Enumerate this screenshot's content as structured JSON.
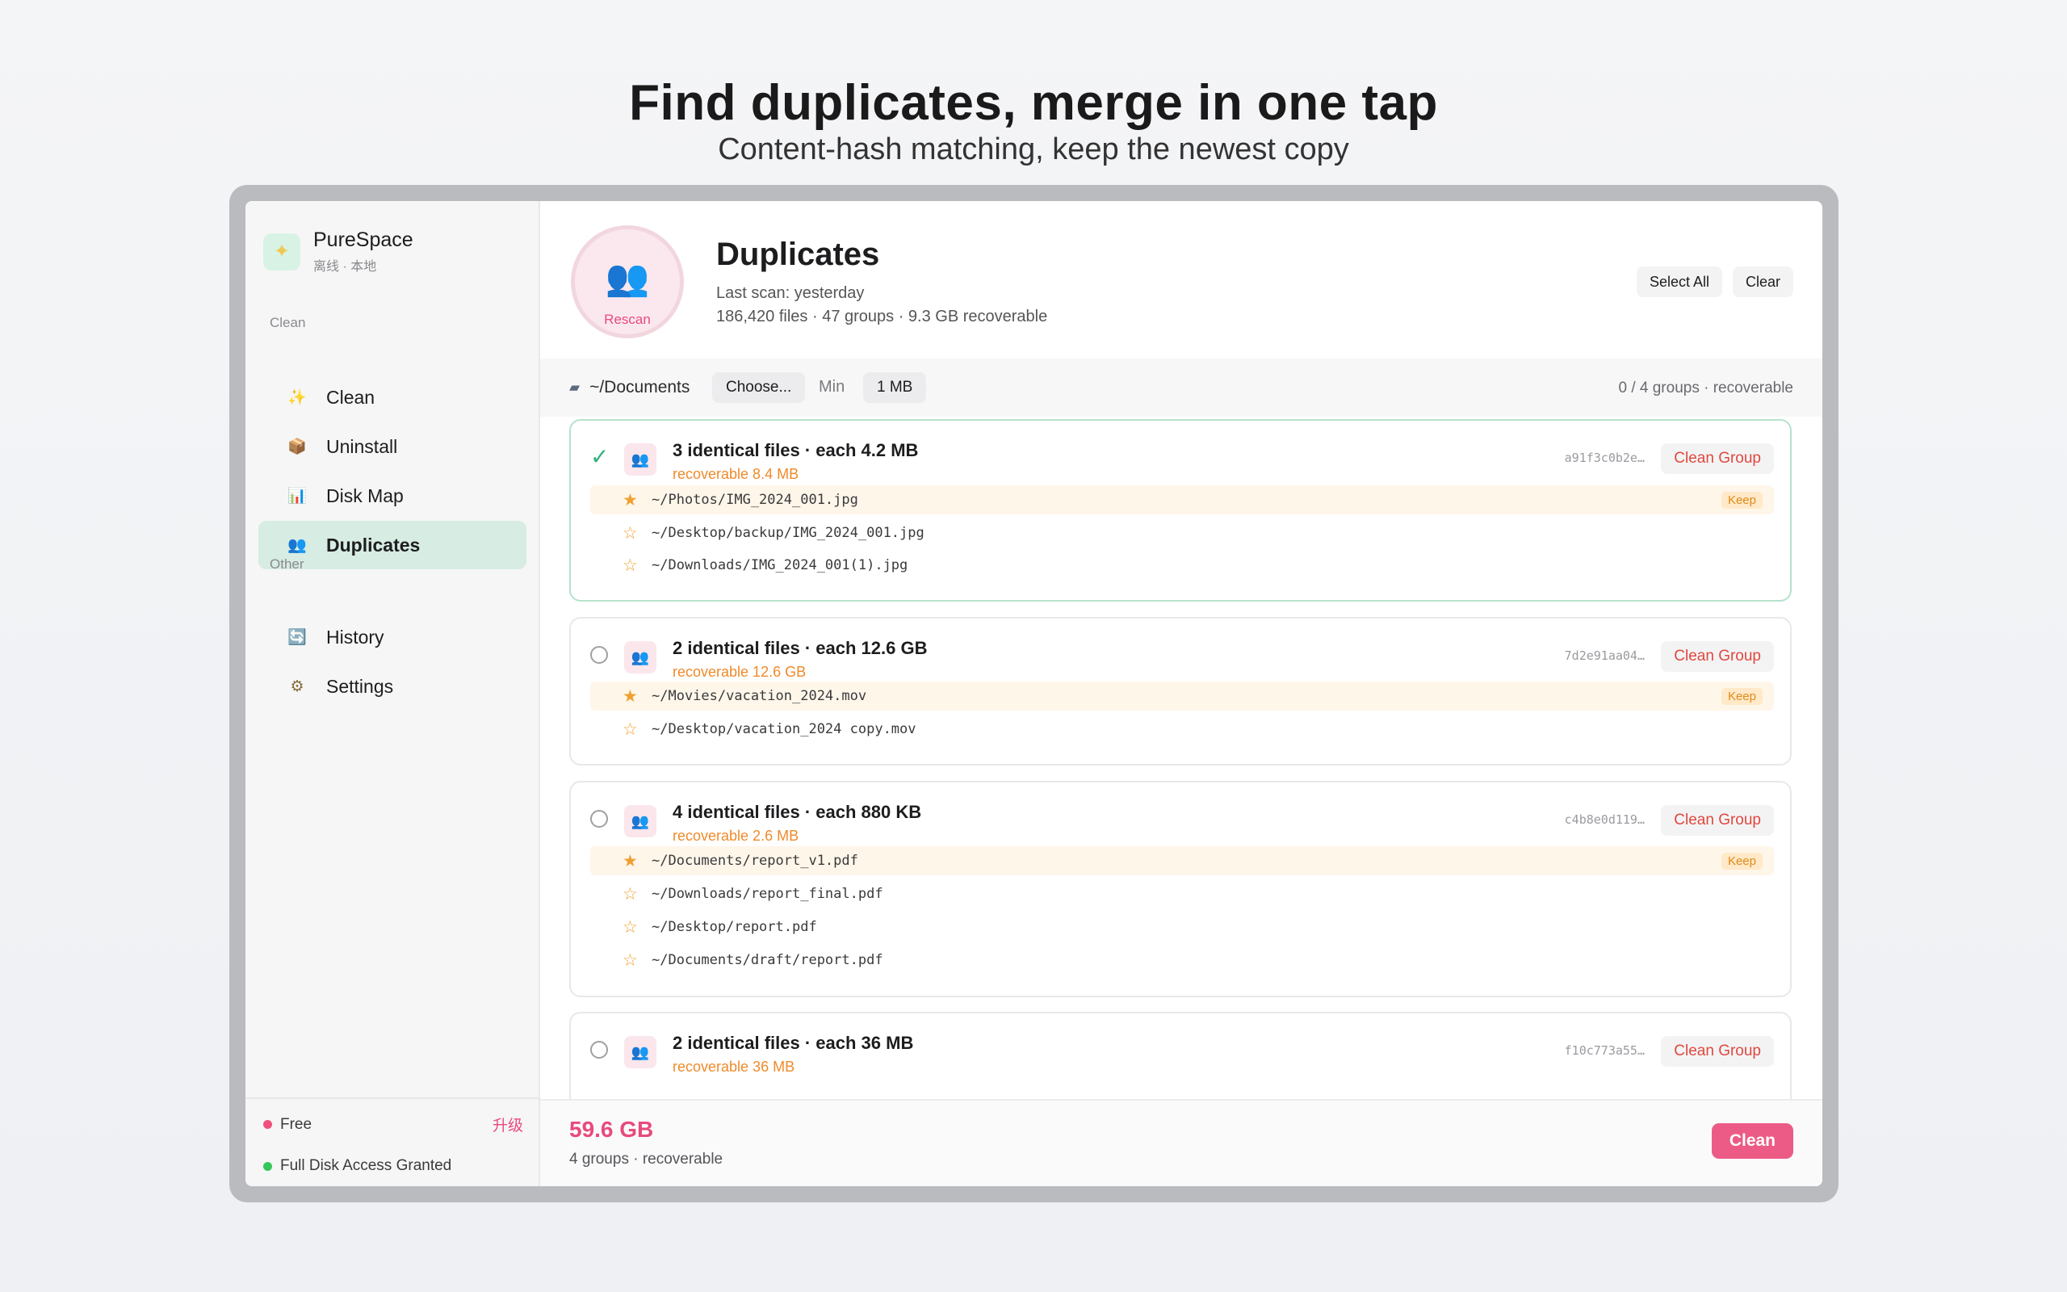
{
  "headline": "Find duplicates, merge in one tap",
  "subheadline": "Content-hash matching, keep the newest copy",
  "app": {
    "name": "PureSpace",
    "subtitle": "离线 · 本地",
    "logo_icon": "sparkles-icon"
  },
  "sidebar": {
    "section_clean": "Clean",
    "section_other": "Other",
    "items": [
      {
        "label": "Clean",
        "icon": "sparkles-icon",
        "glyph": "✨"
      },
      {
        "label": "Uninstall",
        "icon": "package-icon",
        "glyph": "📦"
      },
      {
        "label": "Disk Map",
        "icon": "bar-chart-icon",
        "glyph": "📊"
      },
      {
        "label": "Duplicates",
        "icon": "people-icon",
        "glyph": "👥",
        "active": true
      },
      {
        "label": "History",
        "icon": "refresh-icon",
        "glyph": "🔄"
      },
      {
        "label": "Settings",
        "icon": "gear-icon",
        "glyph": "⚙"
      }
    ],
    "plan": "Free",
    "upgrade": "升级",
    "access": "Full Disk Access Granted",
    "plan_dot_color": "#f0507c",
    "access_dot_color": "#34c759"
  },
  "hero": {
    "rescan_label": "Rescan",
    "title": "Duplicates",
    "last_scan": "Last scan: yesterday",
    "stats": "186,420 files · 47 groups · 9.3 GB recoverable",
    "select_all": "Select All",
    "clear": "Clear"
  },
  "toolbar": {
    "folder": "~/Documents",
    "choose": "Choose...",
    "min_label": "Min",
    "min_value": "1 MB",
    "summary": "0 / 4 groups · recoverable"
  },
  "groups": [
    {
      "title": "3 identical files · each 4.2 MB",
      "recoverable": "recoverable 8.4 MB",
      "hash": "a91f3c0b2e…",
      "clean": "Clean Group",
      "selected": true,
      "files": [
        {
          "path": "~/Photos/IMG_2024_001.jpg",
          "keep": "Keep"
        },
        {
          "path": "~/Desktop/backup/IMG_2024_001.jpg"
        },
        {
          "path": "~/Downloads/IMG_2024_001(1).jpg"
        }
      ]
    },
    {
      "title": "2 identical files · each 12.6 GB",
      "recoverable": "recoverable 12.6 GB",
      "hash": "7d2e91aa04…",
      "clean": "Clean Group",
      "selected": false,
      "files": [
        {
          "path": "~/Movies/vacation_2024.mov",
          "keep": "Keep"
        },
        {
          "path": "~/Desktop/vacation_2024 copy.mov"
        }
      ]
    },
    {
      "title": "4 identical files · each 880 KB",
      "recoverable": "recoverable 2.6 MB",
      "hash": "c4b8e0d119…",
      "clean": "Clean Group",
      "selected": false,
      "files": [
        {
          "path": "~/Documents/report_v1.pdf",
          "keep": "Keep"
        },
        {
          "path": "~/Downloads/report_final.pdf"
        },
        {
          "path": "~/Desktop/report.pdf"
        },
        {
          "path": "~/Documents/draft/report.pdf"
        }
      ]
    },
    {
      "title": "2 identical files · each 36 MB",
      "recoverable": "recoverable 36 MB",
      "hash": "f10c773a55…",
      "clean": "Clean Group",
      "selected": false,
      "files": []
    }
  ],
  "footer": {
    "total": "59.6 GB",
    "sub": "4 groups · recoverable",
    "clean": "Clean"
  }
}
